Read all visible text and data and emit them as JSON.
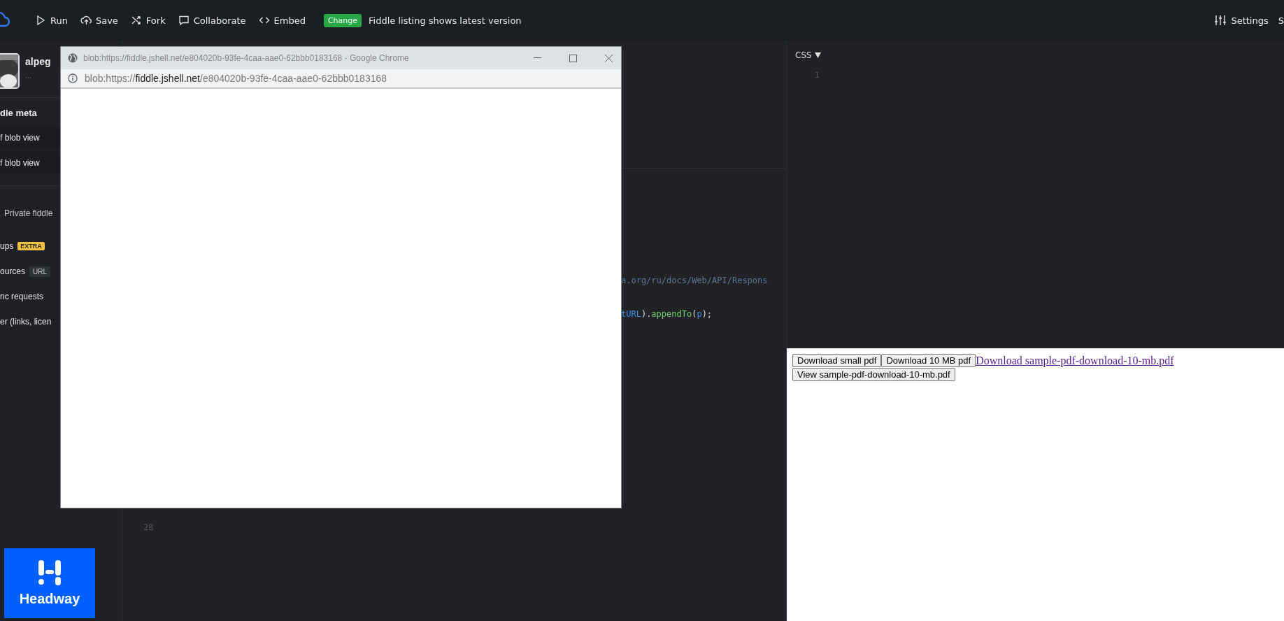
{
  "toolbar": {
    "buttons": [
      {
        "kind": "run",
        "label": "Run"
      },
      {
        "kind": "save",
        "label": "Save"
      },
      {
        "kind": "fork",
        "label": "Fork"
      },
      {
        "kind": "collaborate",
        "label": "Collaborate"
      },
      {
        "kind": "embed",
        "label": "Embed"
      }
    ],
    "badge": "Change",
    "notice": "Fiddle listing shows latest version",
    "settings": "Settings",
    "edge_item": "S"
  },
  "sidebar": {
    "user": {
      "name": "alpeg",
      "menu": "..."
    },
    "items": [
      {
        "kind": "heading",
        "label": "dle meta"
      },
      {
        "kind": "field",
        "label": "f blob view"
      },
      {
        "kind": "field",
        "label": "f blob view"
      },
      {
        "kind": "option",
        "label": "Private fiddle"
      },
      {
        "kind": "link",
        "label": "ups",
        "badge": "EXTRA"
      },
      {
        "kind": "link",
        "label": "ources",
        "tag": "URL"
      },
      {
        "kind": "link",
        "label": "nc requests"
      },
      {
        "kind": "link",
        "label": "er (links, licen"
      }
    ],
    "ad": {
      "brand": "Headway"
    }
  },
  "js_editor": {
    "lines": [
      {
        "tokens": [
          {
            "kind": "comment",
            "text": "a.org/ru/docs/Web/API/Respons"
          }
        ]
      },
      {
        "tokens": [
          {
            "kind": "name",
            "text": "tURL"
          },
          {
            "kind": "punct",
            "text": ")."
          },
          {
            "kind": "method",
            "text": "appendTo"
          },
          {
            "kind": "punct",
            "text": "("
          },
          {
            "kind": "name",
            "text": "p"
          },
          {
            "kind": "punct",
            "text": ");"
          }
        ]
      }
    ],
    "line_number": "28"
  },
  "css_editor": {
    "label": "CSS",
    "line_number": "1"
  },
  "result": {
    "buttons": [
      "Download small pdf",
      "Download 10 MB pdf"
    ],
    "link": "Download sample-pdf-download-10-mb.pdf",
    "view_button": "View sample-pdf-download-10-mb.pdf"
  },
  "popup": {
    "title": "blob:https://fiddle.jshell.net/e804020b-93fe-4caa-aae0-62bbb0183168 - Google Chrome",
    "address": {
      "prefix": "blob:https://",
      "host": "fiddle.jshell.net",
      "path": "/e804020b-93fe-4caa-aae0-62bbb0183168"
    }
  }
}
